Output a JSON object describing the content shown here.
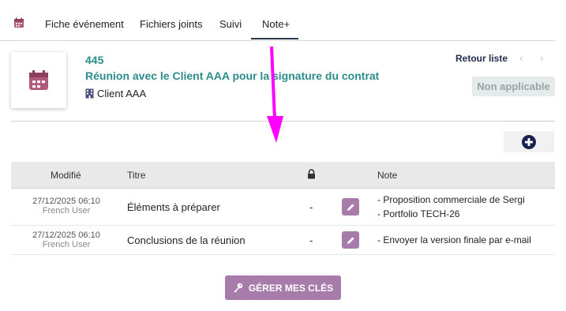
{
  "tabs": [
    {
      "label": "Fiche événement"
    },
    {
      "label": "Fichiers joints"
    },
    {
      "label": "Suivi"
    },
    {
      "label": "Note+"
    }
  ],
  "active_tab": "Note+",
  "header": {
    "ref": "445",
    "title": "Réunion avec le Client AAA pour la signature du contrat",
    "client": "Client AAA",
    "retour_label": "Retour liste",
    "prev_icon": "‹",
    "next_icon": "›",
    "status": "Non applicable"
  },
  "table": {
    "columns": [
      "Modifié",
      "Titre",
      "lock-icon",
      "Note"
    ],
    "rows": [
      {
        "date": "27/12/2025 06:10",
        "user": "French User",
        "title": "Éléments à préparer",
        "lock": "-",
        "note_lines": [
          "- Proposition commerciale de Sergi",
          "- Portfolio TECH-26"
        ]
      },
      {
        "date": "27/12/2025 06:10",
        "user": "French User",
        "title": "Conclusions de la réunion",
        "lock": "-",
        "note_lines": [
          "- Envoyer la version finale par e-mail"
        ]
      }
    ]
  },
  "keys_button": "GÉRER MES CLÉS",
  "colors": {
    "accent": "#a77cab",
    "title": "#2b8c8b",
    "annotation_arrow": "#ff00ff"
  }
}
